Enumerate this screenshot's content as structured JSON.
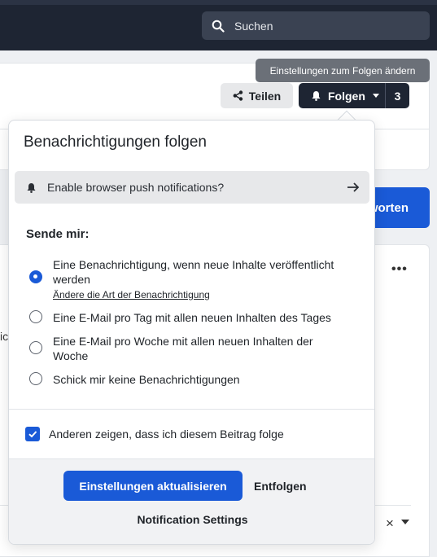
{
  "header": {
    "search_placeholder": "Suchen"
  },
  "tooltip": "Einstellungen zum Folgen ändern",
  "toolbar": {
    "share_label": "Teilen",
    "follow_label": "Folgen",
    "follow_count": "3"
  },
  "background": {
    "reply_label": "worten",
    "more_label": "•••",
    "partial_text": "ic",
    "close_glyph": "×"
  },
  "popup": {
    "title": "Benachrichtigungen folgen",
    "push_prompt": "Enable browser push notifications?",
    "send_me_label": "Sende mir:",
    "options": [
      {
        "label": "Eine Benachrichtigung, wenn neue Inhalte veröffentlicht werden",
        "sublink": "Ändere die Art der Benachrichtigung",
        "selected": true
      },
      {
        "label": "Eine E-Mail pro Tag mit allen neuen Inhalten des Tages",
        "selected": false
      },
      {
        "label": "Eine E-Mail pro Woche mit allen neuen Inhalten der Woche",
        "selected": false
      },
      {
        "label": "Schick mir keine Benachrichtigungen",
        "selected": false
      }
    ],
    "show_following_label": "Anderen zeigen, dass ich diesem Beitrag folge",
    "show_following_checked": true,
    "update_button": "Einstellungen aktualisieren",
    "unfollow_button": "Entfolgen",
    "notification_settings": "Notification Settings"
  },
  "colors": {
    "primary": "#1a5ad7",
    "header_bg": "#1e2533",
    "tooltip_bg": "#6b7078"
  },
  "icons": [
    "search-icon",
    "share-icon",
    "bell-icon",
    "chevron-down-icon",
    "arrow-right-icon",
    "check-icon",
    "close-icon",
    "more-icon"
  ]
}
